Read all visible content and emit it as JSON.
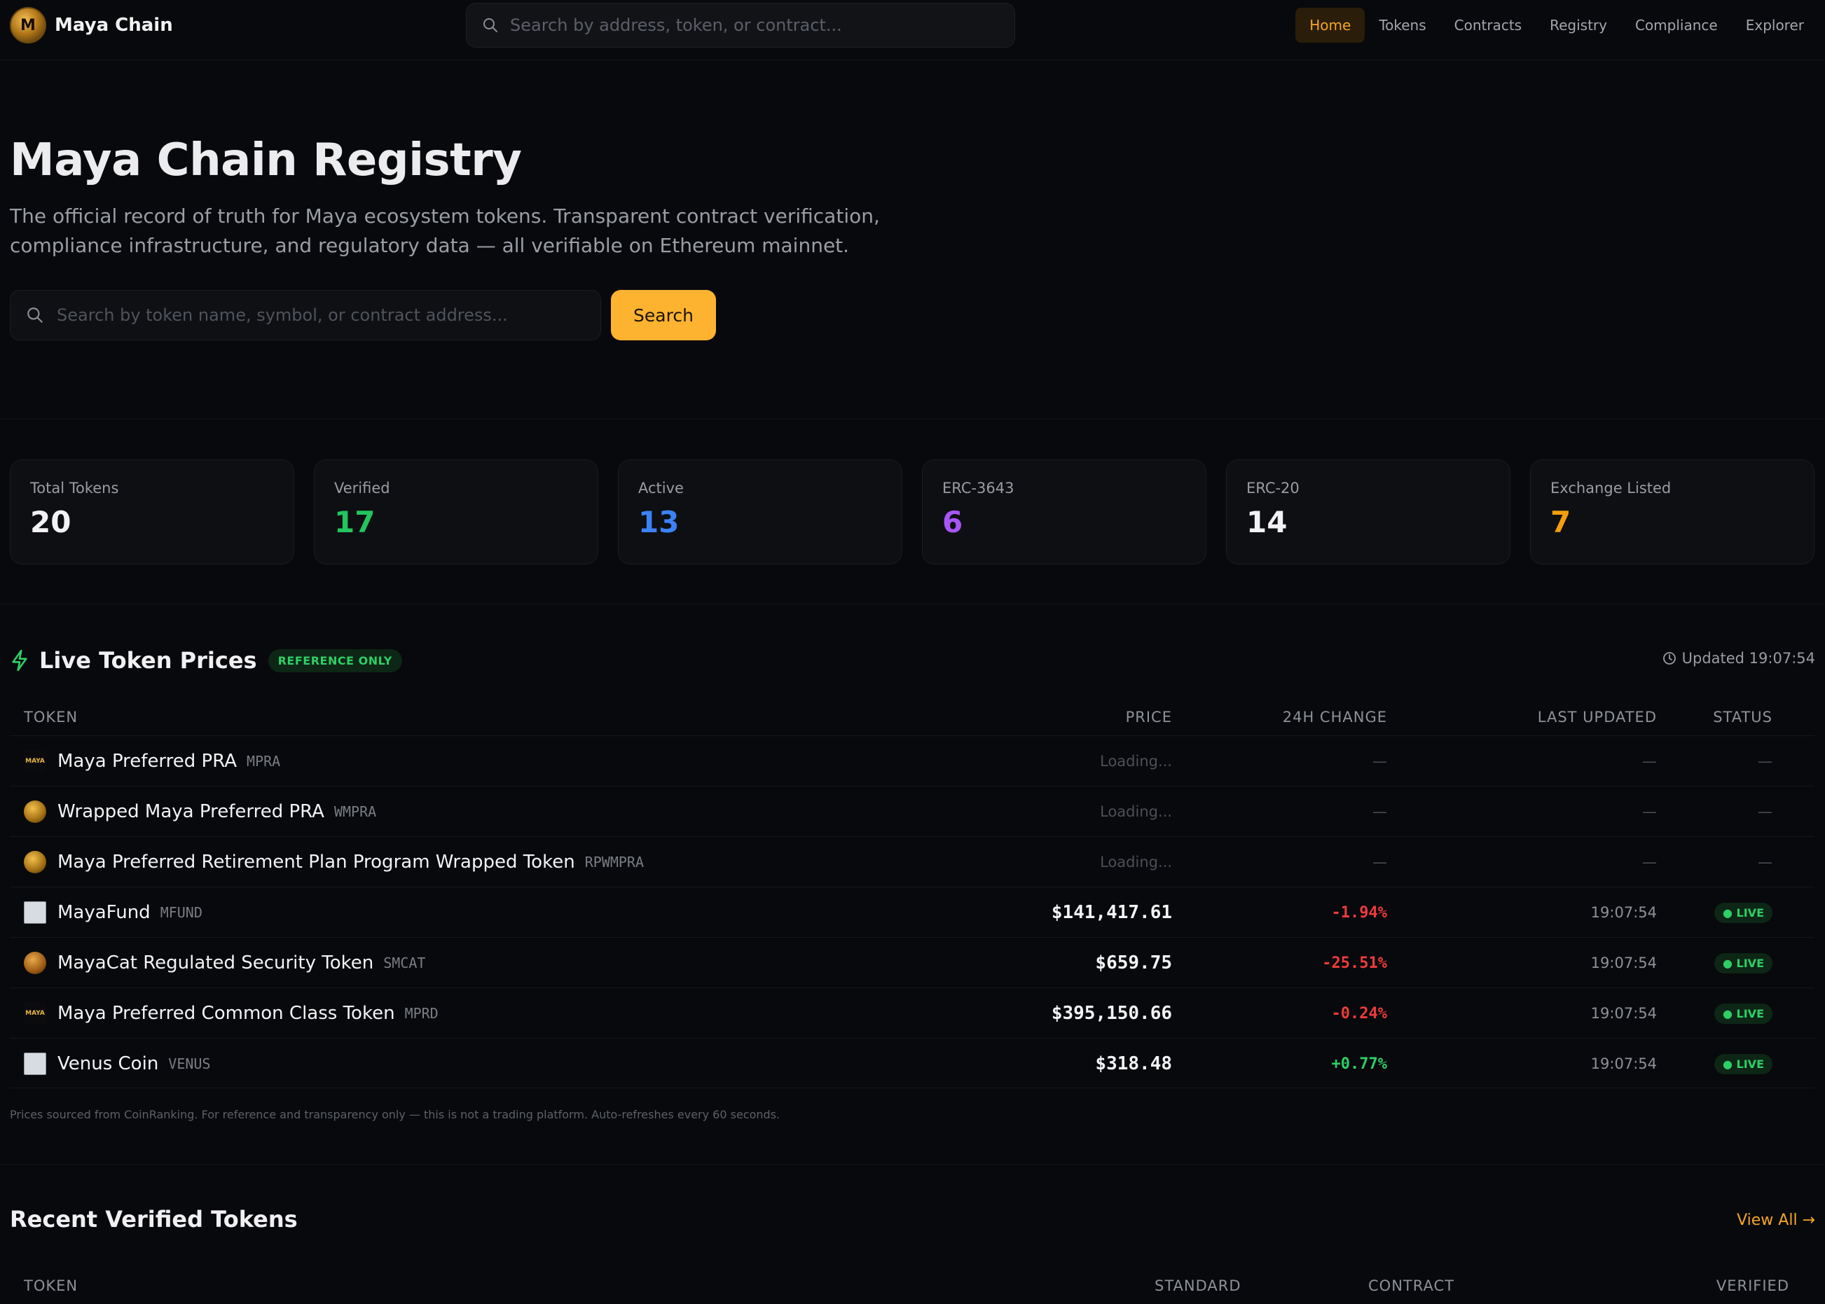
{
  "app": {
    "name": "Maya Chain",
    "logo_text": "M"
  },
  "topbar": {
    "search_placeholder": "Search by address, token, or contract...",
    "nav": [
      "Home",
      "Tokens",
      "Contracts",
      "Registry",
      "Compliance",
      "Explorer"
    ],
    "active_nav": "Home"
  },
  "hero": {
    "title": "Maya Chain Registry",
    "description": "The official record of truth for Maya ecosystem tokens. Transparent contract verification, compliance infrastructure, and regulatory data — all verifiable on Ethereum mainnet.",
    "search_placeholder": "Search by token name, symbol, or contract address...",
    "search_button": "Search"
  },
  "stats": [
    {
      "label": "Total Tokens",
      "value": "20",
      "color": "#f2f2f4"
    },
    {
      "label": "Verified",
      "value": "17",
      "color": "#22c55e"
    },
    {
      "label": "Active",
      "value": "13",
      "color": "#3b82f6"
    },
    {
      "label": "ERC-3643",
      "value": "6",
      "color": "#a855f7"
    },
    {
      "label": "ERC-20",
      "value": "14",
      "color": "#f2f2f4"
    },
    {
      "label": "Exchange Listed",
      "value": "7",
      "color": "#f59e0b"
    }
  ],
  "live_prices": {
    "title": "Live Token Prices",
    "badge": "REFERENCE ONLY",
    "updated": "Updated 19:07:54",
    "columns": {
      "token": "TOKEN",
      "price": "PRICE",
      "change": "24H CHANGE",
      "last_updated": "LAST UPDATED",
      "status": "STATUS"
    },
    "rows": [
      {
        "icon": "maya-pra-icon",
        "icon_text": "MAYA",
        "name": "Maya Preferred PRA",
        "symbol": "MPRA",
        "price": "Loading...",
        "change": "—",
        "time": "—",
        "status": "—"
      },
      {
        "icon": "gold-coin-icon",
        "icon_text": "",
        "name": "Wrapped Maya Preferred PRA",
        "symbol": "WMPRA",
        "price": "Loading...",
        "change": "—",
        "time": "—",
        "status": "—"
      },
      {
        "icon": "gold-coin-icon",
        "icon_text": "",
        "name": "Maya Preferred Retirement Plan Program Wrapped Token",
        "symbol": "RPWMPRA",
        "price": "Loading...",
        "change": "—",
        "time": "—",
        "status": "—"
      },
      {
        "icon": "broken-image-icon",
        "icon_text": "",
        "name": "MayaFund",
        "symbol": "MFUND",
        "price": "$141,417.61",
        "change": "-1.94%",
        "time": "19:07:54",
        "status": "● LIVE"
      },
      {
        "icon": "cat-coin-icon",
        "icon_text": "",
        "name": "MayaCat Regulated Security Token",
        "symbol": "SMCAT",
        "price": "$659.75",
        "change": "-25.51%",
        "time": "19:07:54",
        "status": "● LIVE"
      },
      {
        "icon": "maya-pra-icon",
        "icon_text": "MAYA",
        "name": "Maya Preferred Common Class Token",
        "symbol": "MPRD",
        "price": "$395,150.66",
        "change": "-0.24%",
        "time": "19:07:54",
        "status": "● LIVE"
      },
      {
        "icon": "broken-image-icon",
        "icon_text": "",
        "name": "Venus Coin",
        "symbol": "VENUS",
        "price": "$318.48",
        "change": "+0.77%",
        "time": "19:07:54",
        "status": "● LIVE"
      }
    ],
    "footnote": "Prices sourced from CoinRanking. For reference and transparency only — this is not a trading platform. Auto-refreshes every 60 seconds."
  },
  "recent_verified": {
    "title": "Recent Verified Tokens",
    "view_all": "View All →",
    "columns": {
      "token": "TOKEN",
      "standard": "STANDARD",
      "contract": "CONTRACT",
      "verified": "VERIFIED"
    }
  },
  "colors": {
    "accent": "#fdb32f",
    "positive": "#2fcf67",
    "negative": "#f03b3b",
    "background": "#08090c"
  }
}
